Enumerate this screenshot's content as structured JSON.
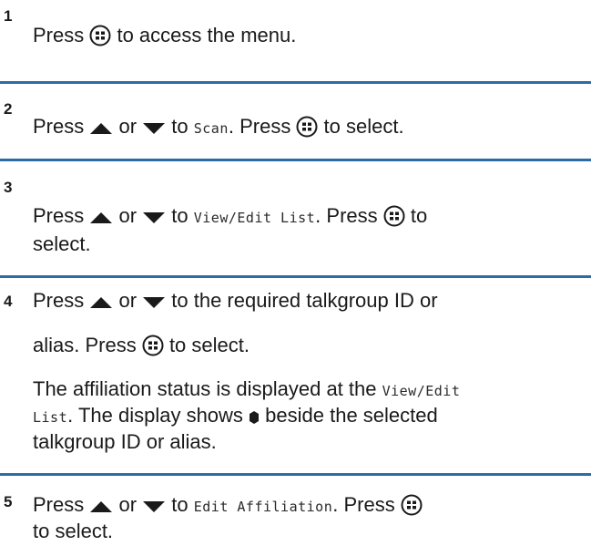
{
  "steps": [
    {
      "number": "1",
      "line1": {
        "a": "Press ",
        "b": " to access the menu."
      }
    },
    {
      "number": "2",
      "line1": {
        "a": "Press ",
        "b": " or ",
        "c": " to ",
        "mono": "Scan",
        "d": ". Press ",
        "e": " to select."
      }
    },
    {
      "number": "3",
      "line1": {
        "a": "Press ",
        "b": " or ",
        "c": " to ",
        "mono": "View/Edit List",
        "d": ". Press ",
        "e": " to"
      },
      "line2": "select."
    },
    {
      "number": "4",
      "line1": {
        "a": "Press ",
        "b": " or ",
        "c": " to the required talkgroup ID or"
      },
      "line2": {
        "a": "alias. Press ",
        "b": " to select."
      },
      "line3": {
        "a": "The affiliation status is displayed at the ",
        "mono": "View/Edit"
      },
      "line4": {
        "mono": "List",
        "a": ". The display shows ",
        "b": " beside the selected"
      },
      "line5": "talkgroup ID or alias."
    },
    {
      "number": "5",
      "line1": {
        "a": "Press ",
        "b": " or ",
        "c": " to ",
        "mono": "Edit Affiliation",
        "d": ". Press "
      },
      "line2": "to select."
    }
  ],
  "icons": {
    "menu": "menu-ok-button-icon",
    "up": "up-arrow-icon",
    "down": "down-arrow-icon",
    "bullet": "selected-marker-icon"
  }
}
